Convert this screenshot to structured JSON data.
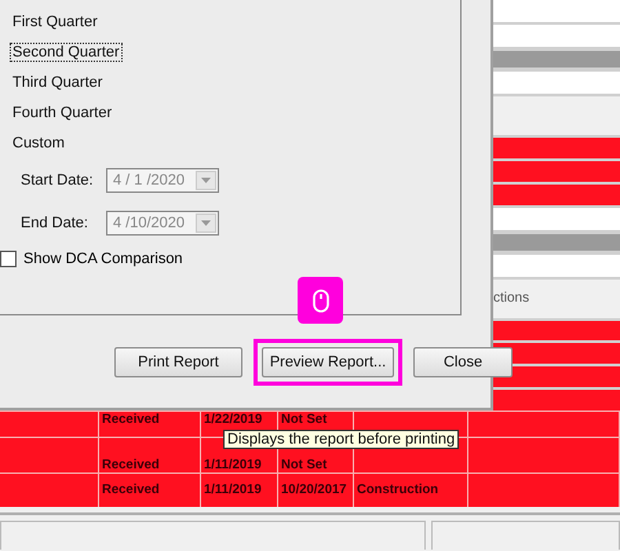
{
  "dialog": {
    "period_options": [
      {
        "label": "First Quarter",
        "focused": false
      },
      {
        "label": "Second Quarter",
        "focused": true
      },
      {
        "label": "Third Quarter",
        "focused": false
      },
      {
        "label": "Fourth Quarter",
        "focused": false
      },
      {
        "label": "Custom",
        "focused": false
      }
    ],
    "start_date": {
      "label": "Start Date:",
      "value": "4 / 1 /2020",
      "disabled": true
    },
    "end_date": {
      "label": "End Date:",
      "value": "4 /10/2020",
      "disabled": true
    },
    "dca_checkbox": {
      "label": "Show DCA Comparison",
      "checked": false
    },
    "buttons": [
      {
        "label": "Print Report",
        "highlighted": false
      },
      {
        "label": "Preview Report...",
        "highlighted": true
      },
      {
        "label": "Close",
        "highlighted": false
      }
    ]
  },
  "tooltip": {
    "text": "Displays the report before printing"
  },
  "background_grid": {
    "side_rows": [
      {
        "kind": "blank"
      },
      {
        "kind": "blank"
      },
      {
        "kind": "band"
      },
      {
        "kind": "blank"
      },
      {
        "kind": "header"
      },
      {
        "kind": "alert"
      },
      {
        "kind": "alert"
      },
      {
        "kind": "alert"
      },
      {
        "kind": "blank"
      },
      {
        "kind": "band"
      },
      {
        "kind": "blank"
      },
      {
        "kind": "header",
        "text": "ctions"
      },
      {
        "kind": "alert"
      },
      {
        "kind": "alert"
      },
      {
        "kind": "alert"
      },
      {
        "kind": "alert"
      }
    ],
    "rows": [
      {
        "kind": "alert",
        "cells": [
          "Received",
          "1/22/2019",
          "Not Set"
        ]
      },
      {
        "kind": "alert",
        "cells": [
          "Received",
          "1/11/2019",
          "Not Set"
        ]
      },
      {
        "kind": "alert",
        "cells": [
          "Received",
          "1/11/2019",
          "10/20/2017",
          "Construction"
        ]
      }
    ]
  }
}
